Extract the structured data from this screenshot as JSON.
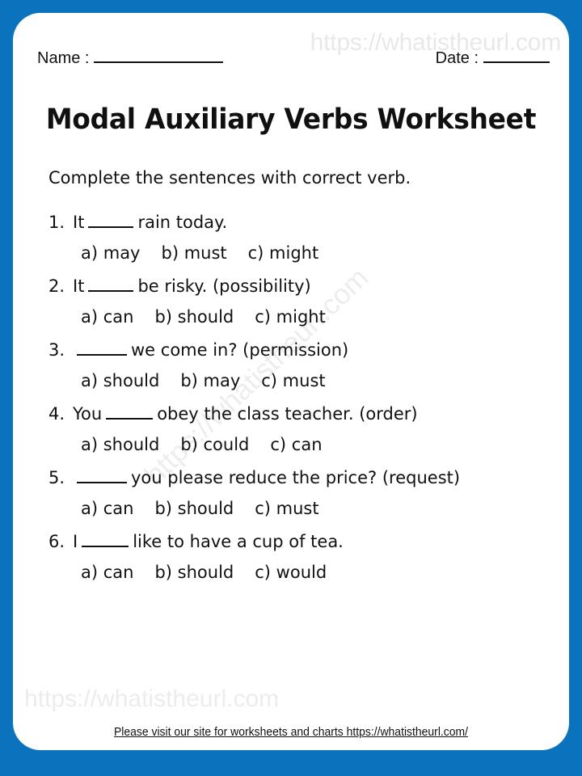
{
  "theme": {
    "border_color": "#0b72be",
    "paper_color": "#ffffff",
    "text_color": "#111111",
    "watermark_color": "#e8e8e8"
  },
  "header": {
    "name_label": "Name :",
    "date_label": "Date :",
    "title": "Modal Auxiliary Verbs Worksheet"
  },
  "instruction": "Complete the sentences with correct verb.",
  "watermarks": {
    "top_right": "https://whatistheurl.com",
    "diagonal": "https://whatistheurl.com",
    "bottom_left": "https://whatistheurl.com"
  },
  "questions": [
    {
      "number": "1.",
      "prefix": "It",
      "suffix": "rain today.",
      "blank_width": 56,
      "options": [
        "a) may",
        "b) must",
        "c) might"
      ]
    },
    {
      "number": "2.",
      "prefix": "It",
      "suffix": "be risky. (possibility)",
      "blank_width": 56,
      "options": [
        "a) can",
        "b) should",
        "c) might"
      ]
    },
    {
      "number": "3.",
      "prefix": "",
      "suffix": "we come in? (permission)",
      "blank_width": 62,
      "options": [
        "a) should",
        "b) may",
        "c) must"
      ]
    },
    {
      "number": "4.",
      "prefix": "You",
      "suffix": "obey the class teacher. (order)",
      "blank_width": 58,
      "options": [
        "a) should",
        "b) could",
        "c) can"
      ]
    },
    {
      "number": "5.",
      "prefix": "",
      "suffix": "you please reduce the price? (request)",
      "blank_width": 62,
      "options": [
        "a) can",
        "b) should",
        "c) must"
      ]
    },
    {
      "number": "6.",
      "prefix": "I",
      "suffix": "like to have a cup of tea.",
      "blank_width": 58,
      "options": [
        "a) can",
        "b) should",
        "c) would"
      ]
    }
  ],
  "footer": {
    "note": "Please visit our site for worksheets and charts https://whatistheurl.com/"
  }
}
